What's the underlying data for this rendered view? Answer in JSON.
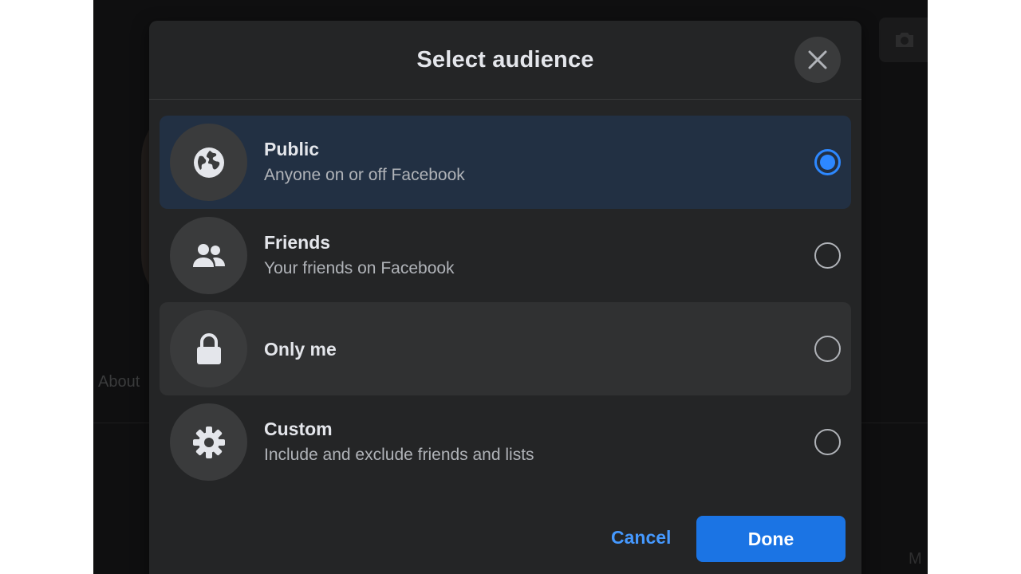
{
  "background": {
    "about_label": "About",
    "truncated_right": "M"
  },
  "dialog": {
    "title": "Select audience",
    "close_icon": "close-icon"
  },
  "options": [
    {
      "icon": "globe-icon",
      "title": "Public",
      "subtitle": "Anyone on or off Facebook",
      "selected": true
    },
    {
      "icon": "friends-icon",
      "title": "Friends",
      "subtitle": "Your friends on Facebook",
      "selected": false
    },
    {
      "icon": "lock-icon",
      "title": "Only me",
      "subtitle": "",
      "selected": false
    },
    {
      "icon": "gear-icon",
      "title": "Custom",
      "subtitle": "Include and exclude friends and lists",
      "selected": false
    }
  ],
  "footer": {
    "cancel_label": "Cancel",
    "done_label": "Done"
  },
  "colors": {
    "accent": "#2d88ff",
    "done_button": "#1b74e4",
    "selected_row": "#223043",
    "dialog_bg": "#242526"
  }
}
